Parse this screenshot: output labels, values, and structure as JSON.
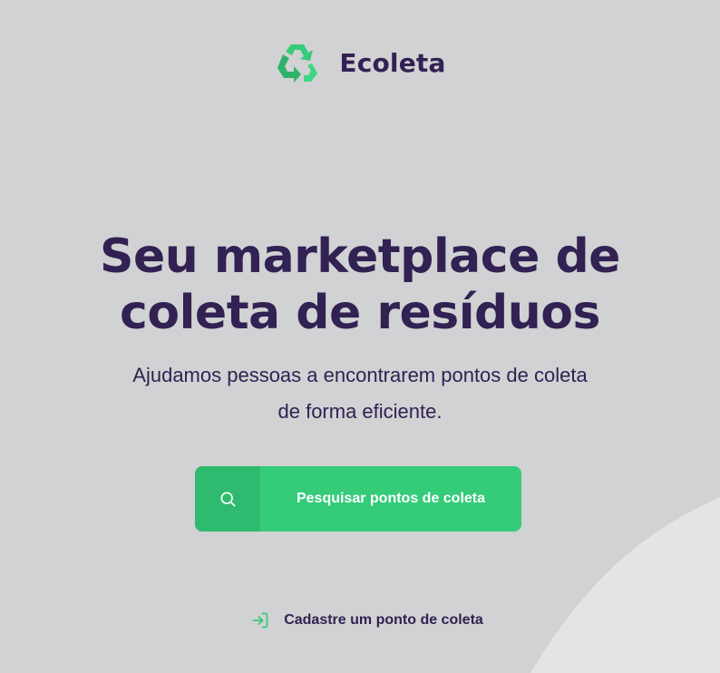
{
  "brand": {
    "name": "Ecoleta",
    "logo_icon": "recycle-icon"
  },
  "hero": {
    "title_line1": "Seu marketplace de",
    "title_line2": "coleta de resíduos",
    "subtitle_line1": "Ajudamos pessoas a encontrarem pontos de coleta",
    "subtitle_line2": "de forma eficiente."
  },
  "search_button": {
    "label": "Pesquisar pontos de coleta",
    "icon": "search-icon"
  },
  "register_link": {
    "label": "Cadastre um ponto de coleta",
    "icon": "log-in-icon"
  },
  "colors": {
    "background": "#d1d2d3",
    "accent": "#34cb79",
    "text": "#322153",
    "shape": "#e3e4e5"
  }
}
